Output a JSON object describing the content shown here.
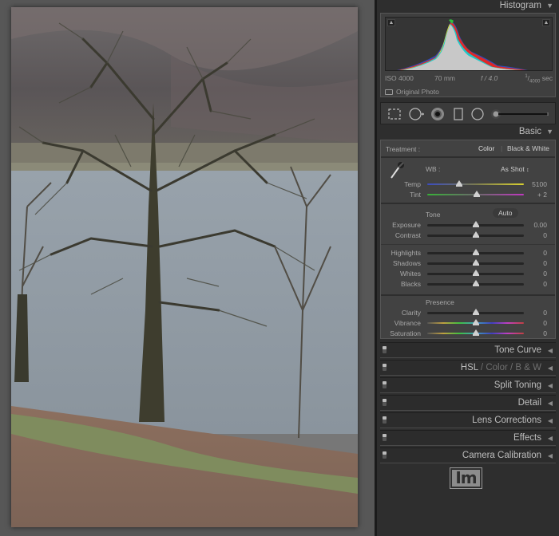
{
  "photo": {
    "description": "Bare oak trees on a bracken-covered hillside above a lake, hills in background"
  },
  "histogram": {
    "title": "Histogram",
    "iso": "ISO 4000",
    "focal_length": "70 mm",
    "aperture": "f / 4.0",
    "shutter_num": "1",
    "shutter_den": "4000",
    "shutter_unit": "sec",
    "original_photo_label": "Original Photo",
    "original_photo_checked": false
  },
  "tools": [
    "crop-overlay",
    "spot-removal",
    "red-eye-correction",
    "graduated-filter",
    "radial-filter",
    "adjustment-brush"
  ],
  "basic": {
    "title": "Basic",
    "treatment_label": "Treatment :",
    "treatment_color": "Color",
    "treatment_separator": "|",
    "treatment_bw": "Black & White",
    "wb_label": "WB :",
    "wb_value": "As Shot",
    "wb_arrows": "↕",
    "temp": {
      "label": "Temp",
      "value": "5100",
      "fraction": 0.33
    },
    "tint": {
      "label": "Tint",
      "value": "+ 2",
      "fraction": 0.51
    },
    "tone_label": "Tone",
    "auto_label": "Auto",
    "tone_sliders": [
      {
        "label": "Exposure",
        "value": "0.00",
        "fraction": 0.5
      },
      {
        "label": "Contrast",
        "value": "0",
        "fraction": 0.5
      }
    ],
    "tone_sliders_2": [
      {
        "label": "Highlights",
        "value": "0",
        "fraction": 0.5
      },
      {
        "label": "Shadows",
        "value": "0",
        "fraction": 0.5
      },
      {
        "label": "Whites",
        "value": "0",
        "fraction": 0.5
      },
      {
        "label": "Blacks",
        "value": "0",
        "fraction": 0.5
      }
    ],
    "presence_label": "Presence",
    "presence_sliders": [
      {
        "label": "Clarity",
        "value": "0",
        "fraction": 0.5
      },
      {
        "label": "Vibrance",
        "value": "0",
        "fraction": 0.5
      },
      {
        "label": "Saturation",
        "value": "0",
        "fraction": 0.5
      }
    ]
  },
  "collapsed_panels": [
    {
      "title": "Tone Curve"
    },
    {
      "title_parts": [
        "HSL",
        " / ",
        "Color",
        " / ",
        "B & W"
      ]
    },
    {
      "title": "Split Toning"
    },
    {
      "title": "Detail"
    },
    {
      "title": "Lens Corrections"
    },
    {
      "title": "Effects"
    },
    {
      "title": "Camera Calibration"
    }
  ],
  "logo_text": "Im",
  "colors": {
    "panel_bg": "#2e2e2e",
    "basic_bg": "#424242",
    "canvas_bg": "#575757"
  }
}
